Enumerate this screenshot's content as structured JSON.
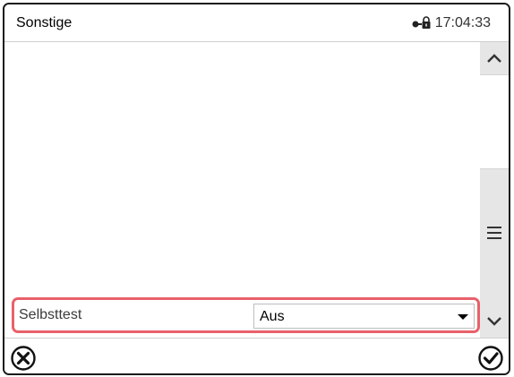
{
  "header": {
    "title": "Sonstige",
    "time": "17:04:33",
    "lock_icon": "door-lock-icon"
  },
  "scrollbar": {
    "up_icon": "chevron-up-icon",
    "down_icon": "chevron-down-icon",
    "grip_icon": "menu-grip-icon"
  },
  "setting": {
    "label": "Selbsttest",
    "value": "Aus"
  },
  "footer": {
    "cancel_icon": "close-circle-icon",
    "confirm_icon": "check-circle-icon"
  },
  "colors": {
    "highlight": "#e8616a",
    "scroll_track": "#e6e6e6"
  }
}
